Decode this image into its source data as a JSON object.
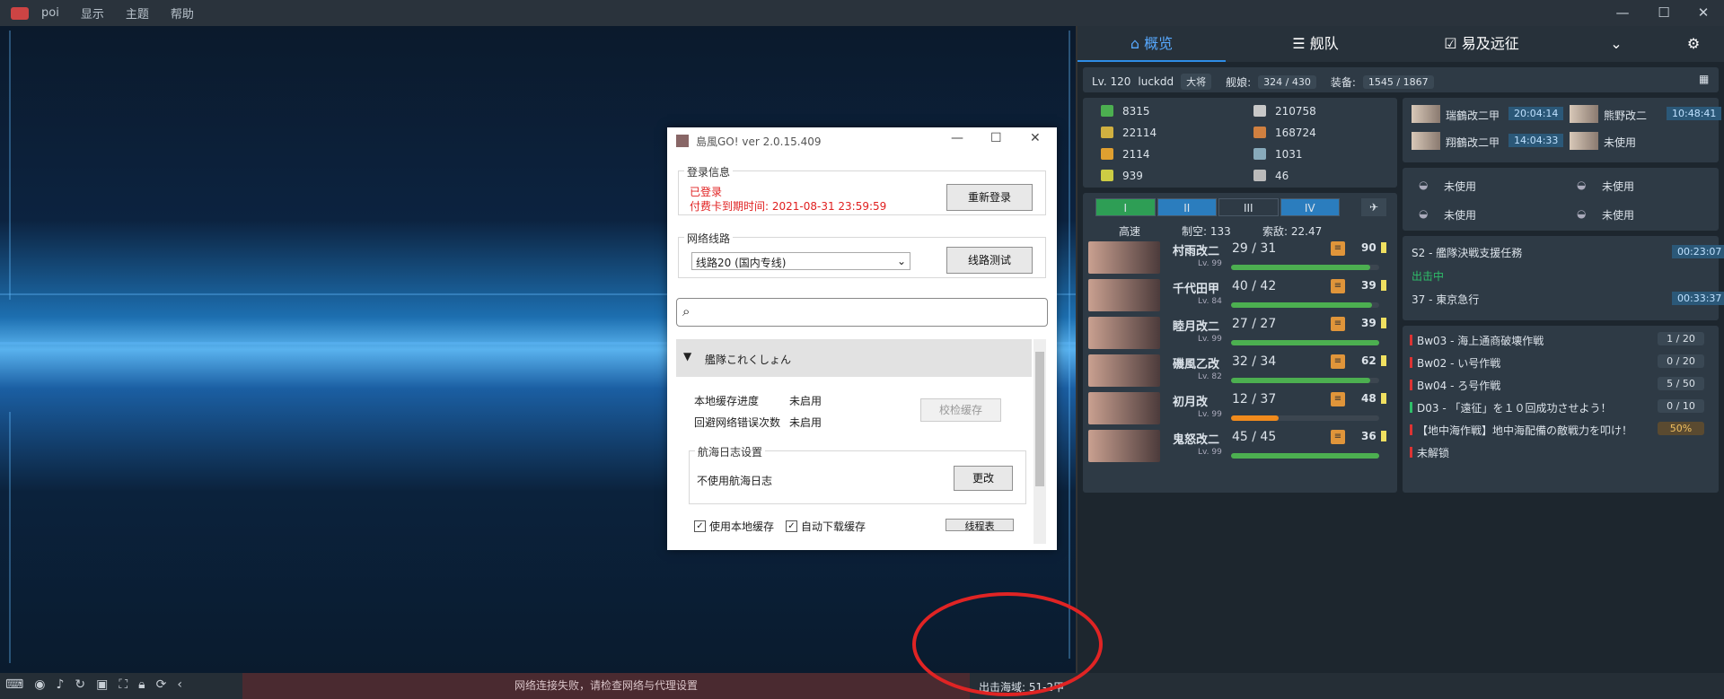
{
  "menu": {
    "app": "poi",
    "display": "显示",
    "theme": "主题",
    "help": "帮助"
  },
  "dialog": {
    "title": "島風GO!  ver 2.0.15.409",
    "login": {
      "legend": "登录信息",
      "status": "已登录",
      "expire": "付费卡到期时间: 2021-08-31 23:59:59",
      "relogin": "重新登录"
    },
    "network": {
      "legend": "网络线路",
      "route": "线路20 (国内专线)",
      "test": "线路测试"
    },
    "search_placeholder": "",
    "section": "艦隊これくしょん",
    "cache_progress_label": "本地缓存进度",
    "cache_progress_value": "未启用",
    "bypass_label": "回避网络错误次数",
    "bypass_value": "未启用",
    "verify": "校检缓存",
    "log_legend": "航海日志设置",
    "log_value": "不使用航海日志",
    "change": "更改",
    "use_cache": "使用本地缓存",
    "auto_download": "自动下载缓存",
    "more": "线程表"
  },
  "tabs": {
    "overview": "概览",
    "fleet": "舰队",
    "expedition": "易及远征"
  },
  "admiral": {
    "level": "Lv. 120",
    "name": "luckdd",
    "rank": "大将",
    "ships_label": "舰娘:",
    "ships": "324 / 430",
    "equip_label": "装备:",
    "equip": "1545 / 1867"
  },
  "resources": [
    {
      "v": "8315",
      "c": "#4caf50"
    },
    {
      "v": "210758",
      "c": "#c8c8c8"
    },
    {
      "v": "22114",
      "c": "#d0b040"
    },
    {
      "v": "168724",
      "c": "#d08040"
    },
    {
      "v": "2114",
      "c": "#e0a030"
    },
    {
      "v": "1031",
      "c": "#8ab"
    },
    {
      "v": "939",
      "c": "#cc4"
    },
    {
      "v": "46",
      "c": "#bbb"
    }
  ],
  "repair": [
    {
      "name": "瑞鶴改二甲",
      "time": "20:04:14"
    },
    {
      "name": "熊野改二",
      "time": "10:48:41"
    },
    {
      "name": "翔鶴改二甲",
      "time": "14:04:33"
    },
    {
      "name": "未使用",
      "time": ""
    }
  ],
  "build": [
    "未使用",
    "未使用",
    "未使用",
    "未使用"
  ],
  "fleet_tabs": [
    "I",
    "II",
    "III",
    "IV"
  ],
  "fleet_info": {
    "speed": "高速",
    "air_label": "制空:",
    "air": "133",
    "los_label": "索敌:",
    "los": "22.47"
  },
  "ships": [
    {
      "name": "村雨改二",
      "lv": "Lv. 99",
      "hp": "29 / 31",
      "pct": 0.94,
      "color": "#4caf50",
      "cond": "90"
    },
    {
      "name": "千代田甲",
      "lv": "Lv. 84",
      "hp": "40 / 42",
      "pct": 0.95,
      "color": "#4caf50",
      "cond": "39"
    },
    {
      "name": "睦月改二",
      "lv": "Lv. 99",
      "hp": "27 / 27",
      "pct": 1,
      "color": "#4caf50",
      "cond": "39"
    },
    {
      "name": "磯風乙改",
      "lv": "Lv. 82",
      "hp": "32 / 34",
      "pct": 0.94,
      "color": "#4caf50",
      "cond": "62"
    },
    {
      "name": "初月改",
      "lv": "Lv. 99",
      "hp": "12 / 37",
      "pct": 0.32,
      "color": "#f08a1c",
      "cond": "48"
    },
    {
      "name": "鬼怒改二",
      "lv": "Lv. 99",
      "hp": "45 / 45",
      "pct": 1,
      "color": "#4caf50",
      "cond": "36"
    }
  ],
  "expedition": {
    "name": "S2 - 艦隊決戦支援任務",
    "time": "00:23:07",
    "status": "出击中",
    "name2": "37 - 東京急行",
    "time2": "00:33:37"
  },
  "quests": [
    {
      "name": "Bw03 - 海上通商破壊作戦",
      "p": "1 / 20"
    },
    {
      "name": "Bw02 - い号作戦",
      "p": "0 / 20"
    },
    {
      "name": "Bw04 - ろ号作戦",
      "p": "5 / 50"
    },
    {
      "name": "D03 - 「遠征」を１０回成功させよう！",
      "p": "0 / 10"
    },
    {
      "name": "【地中海作戦】地中海配備の敵戦力を叩け！",
      "p": "50%"
    },
    {
      "name": "未解锁",
      "p": ""
    }
  ],
  "status": {
    "net_msg": "网络连接失败，请检查网络与代理设置",
    "map": "出击海域: 51-2甲"
  }
}
